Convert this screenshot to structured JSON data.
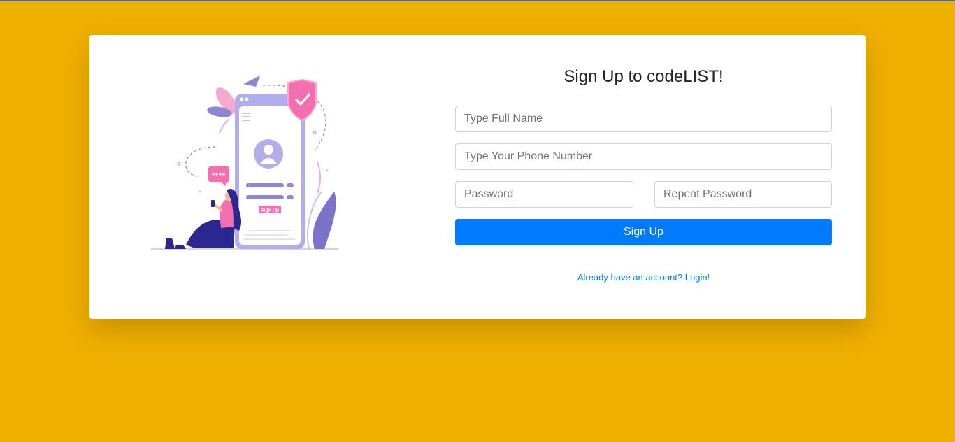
{
  "page": {
    "background_color": "#f0b000",
    "accent_color": "#007bff"
  },
  "signup": {
    "title": "Sign Up to codeLIST!",
    "full_name_placeholder": "Type Full Name",
    "phone_placeholder": "Type Your Phone Number",
    "password_placeholder": "Password",
    "repeat_password_placeholder": "Repeat Password",
    "submit_label": "Sign Up",
    "login_link": "Already have an account? Login!"
  },
  "illustration": {
    "phone_button_label": "Sign Up"
  }
}
